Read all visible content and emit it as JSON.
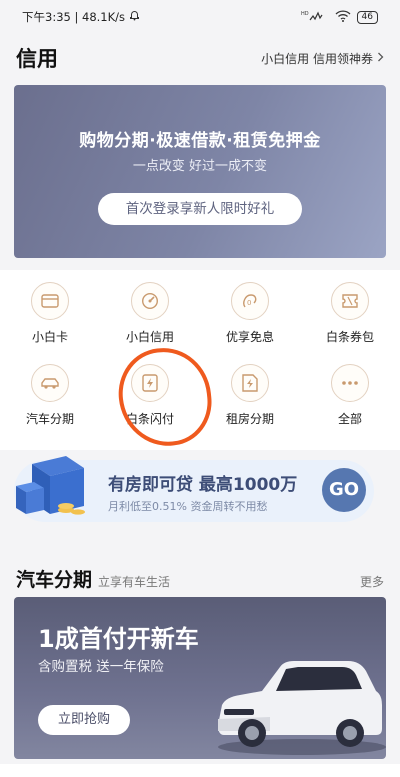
{
  "status_bar": {
    "time_speed": "下午3:35 | 48.1K/s",
    "battery": "46"
  },
  "header": {
    "title": "信用",
    "link": "小白信用 信用领神券"
  },
  "hero": {
    "title": "购物分期·极速借款·租赁免押金",
    "subtitle": "一点改变 好过一成不变",
    "button": "首次登录享新人限时好礼"
  },
  "services": [
    {
      "label": "小白卡",
      "icon": "card-icon"
    },
    {
      "label": "小白信用",
      "icon": "credit-gauge-icon"
    },
    {
      "label": "优享免息",
      "icon": "interest-free-icon"
    },
    {
      "label": "白条券包",
      "icon": "coupon-icon"
    },
    {
      "label": "汽车分期",
      "icon": "car-icon"
    },
    {
      "label": "白条闪付",
      "icon": "lightning-pay-icon"
    },
    {
      "label": "租房分期",
      "icon": "rent-icon"
    },
    {
      "label": "全部",
      "icon": "more-dots-icon"
    }
  ],
  "loan_banner": {
    "title": "有房即可贷 最高1000万",
    "subtitle": "月利低至0.51% 资金周转不用愁",
    "go": "GO"
  },
  "car_section": {
    "title": "汽车分期",
    "subtitle": "立享有车生活",
    "more": "更多",
    "banner_title": "1成首付开新车",
    "banner_subtitle": "含购置税 送一年保险",
    "banner_button": "立即抢购"
  },
  "colors": {
    "accent": "#ef5a1e",
    "hero_bg": "#7e85a6",
    "go_button": "#5677b0"
  }
}
